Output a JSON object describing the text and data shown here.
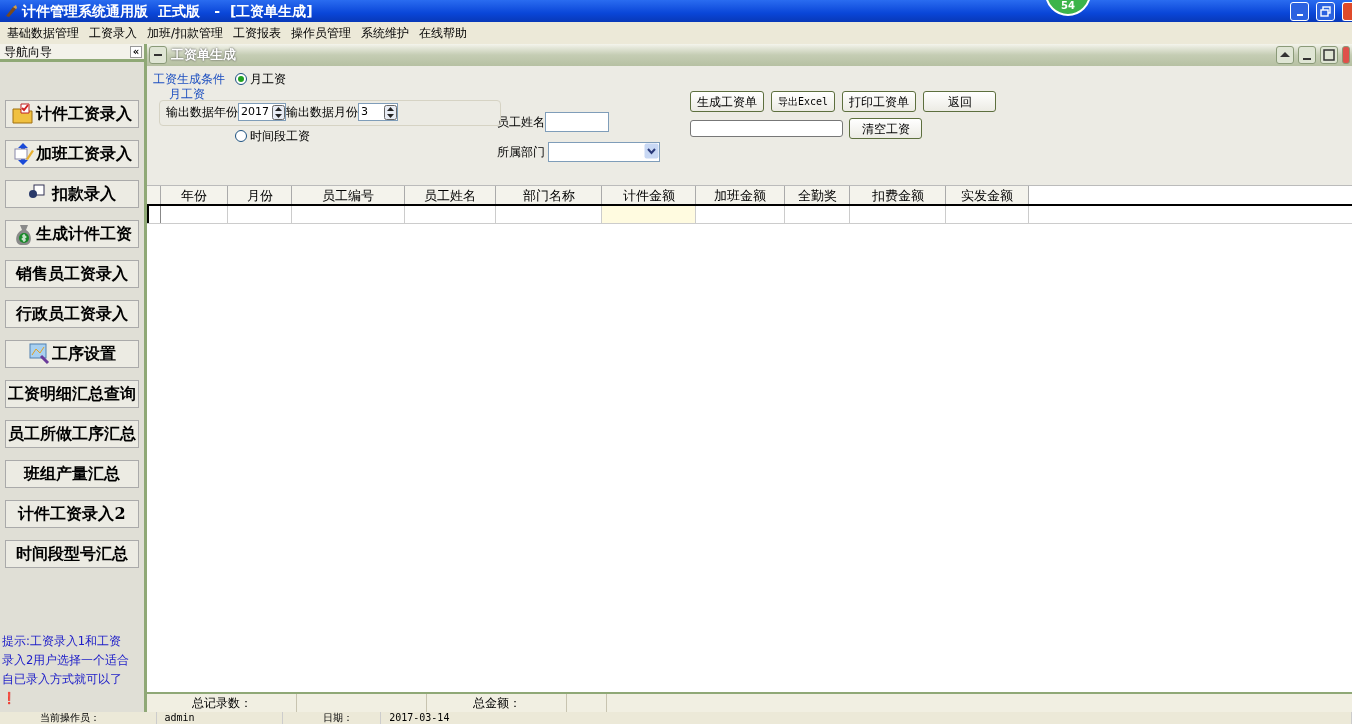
{
  "window": {
    "title": "计件管理系统通用版  正式版   -  [工资单生成]",
    "badge": "54"
  },
  "menu": [
    "基础数据管理",
    "工资录入",
    "加班/扣款管理",
    "工资报表",
    "操作员管理",
    "系统维护",
    "在线帮助"
  ],
  "sidebar": {
    "title": "导航向导",
    "collapse": "«",
    "items": [
      {
        "label": "计件工资录入"
      },
      {
        "label": "加班工资录入"
      },
      {
        "label": "扣款录入"
      },
      {
        "label": "生成计件工资"
      },
      {
        "label": "销售员工资录入"
      },
      {
        "label": "行政员工资录入"
      },
      {
        "label": "工序设置"
      },
      {
        "label": "工资明细汇总查询"
      },
      {
        "label": "员工所做工序汇总"
      },
      {
        "label": "班组产量汇总"
      },
      {
        "label": "计件工资录入2"
      },
      {
        "label": "时间段型号汇总"
      }
    ],
    "hint": "提示:工资录入1和工资录入2用户选择一个适合自已录入方式就可以了❗"
  },
  "panel": {
    "title": "工资单生成",
    "conditions": {
      "legend": "工资生成条件",
      "radios": [
        {
          "label": "月工资",
          "checked": true
        },
        {
          "label": "时间段工资",
          "checked": false
        }
      ],
      "group": "月工资",
      "year_label": "输出数据年份",
      "year": "2017",
      "month_label": "输出数据月份",
      "month": "3"
    },
    "employee_label": "员工姓名",
    "department_label": "所属部门",
    "buttons": [
      "生成工资单",
      "导出Excel",
      "打印工资单",
      "返回"
    ],
    "clear_button": "清空工资"
  },
  "table": {
    "columns": [
      {
        "label": "年份",
        "selected": false
      },
      {
        "label": "月份",
        "selected": false
      },
      {
        "label": "员工编号",
        "selected": false
      },
      {
        "label": "员工姓名",
        "selected": false
      },
      {
        "label": "部门名称",
        "selected": false
      },
      {
        "label": "计件金额",
        "selected": true
      },
      {
        "label": "加班金额",
        "selected": false
      },
      {
        "label": "全勤奖",
        "selected": false
      },
      {
        "label": "扣费金额",
        "selected": false
      },
      {
        "label": "实发金额",
        "selected": false
      }
    ]
  },
  "footer": [
    "总记录数：",
    "总金额："
  ],
  "status_bar": [
    "当前操作员：",
    "admin",
    "日期：",
    "2017-03-14"
  ]
}
